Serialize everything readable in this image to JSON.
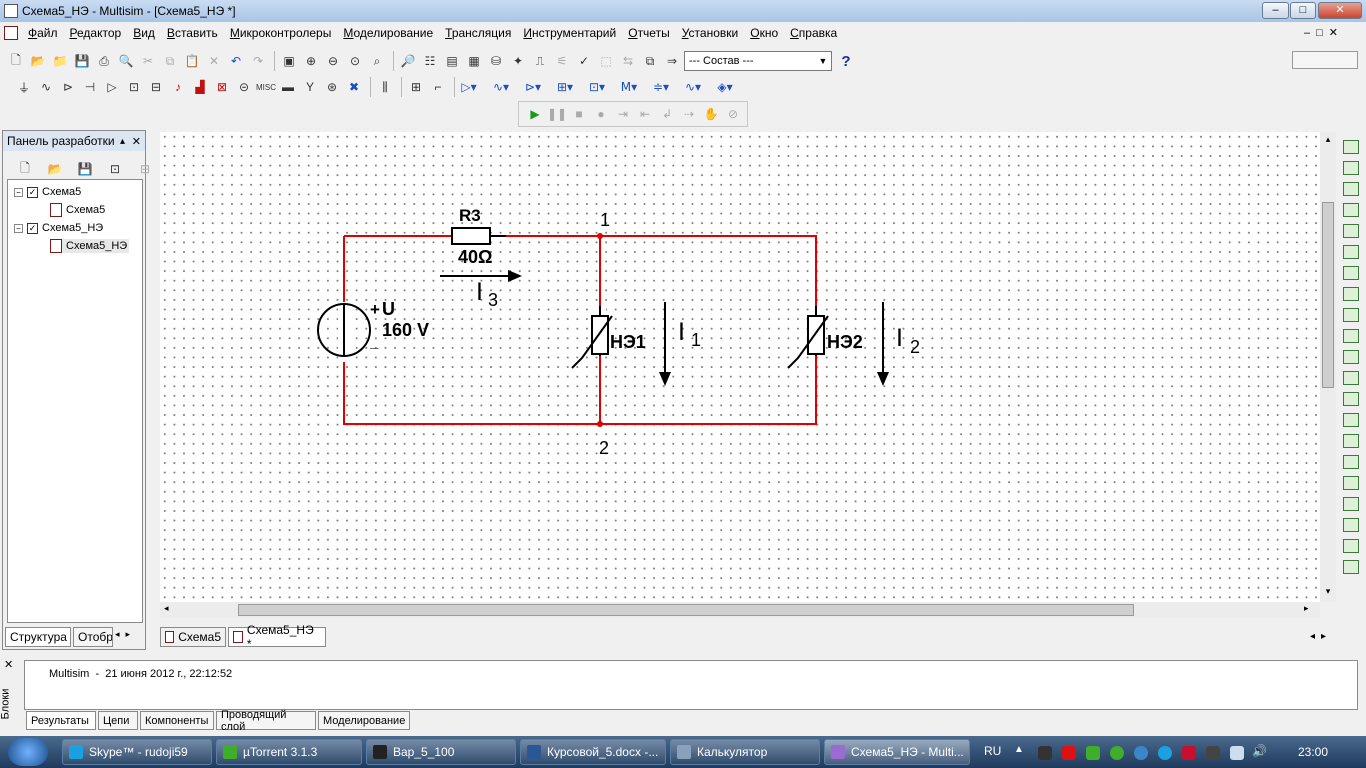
{
  "window": {
    "title": "Схема5_НЭ - Multisim - [Схема5_НЭ *]",
    "min_symbol": "‒",
    "max_symbol": "□",
    "close_symbol": "✕"
  },
  "menu": [
    "Файл",
    "Редактор",
    "Вид",
    "Вставить",
    "Микроконтролеры",
    "Моделирование",
    "Трансляция",
    "Инструментарий",
    "Отчеты",
    "Установки",
    "Окно",
    "Справка"
  ],
  "toolbar": {
    "combo_value": "--- Состав ---",
    "help_symbol": "?"
  },
  "design_panel": {
    "title": "Панель разработки",
    "tree": [
      {
        "label": "Схема5",
        "type": "folder"
      },
      {
        "label": "Схема5",
        "type": "sheet"
      },
      {
        "label": "Схема5_НЭ",
        "type": "folder"
      },
      {
        "label": "Схема5_НЭ",
        "type": "sheet"
      }
    ],
    "tabs": [
      "Структура",
      "Отобр"
    ]
  },
  "circuit": {
    "source": {
      "ref": "U",
      "value": "160 V",
      "plus": "+",
      "minus": "_"
    },
    "resistor": {
      "ref": "R3",
      "value": "40Ω"
    },
    "nodes": [
      "1",
      "2"
    ],
    "nonlinear": [
      {
        "ref": "НЭ1"
      },
      {
        "ref": "НЭ2"
      }
    ],
    "currents": [
      {
        "letter": "I",
        "index": "3"
      },
      {
        "letter": "I",
        "index": "1"
      },
      {
        "letter": "I",
        "index": "2"
      }
    ],
    "wire_color": "#e00000"
  },
  "sheet_tabs": [
    "Схема5",
    "Схема5_НЭ *"
  ],
  "bottom": {
    "side_label": "Блоки",
    "message": "Multisim  -  21 июня 2012 г., 22:12:52",
    "tabs": [
      "Результаты",
      "Цепи",
      "Компоненты",
      "Проводящий слой",
      "Моделирование"
    ]
  },
  "taskbar": {
    "items": [
      "Skype™ - rudoji59",
      "µTorrent 3.1.3",
      "Вар_5_100",
      "Курсовой_5.docx -...",
      "Калькулятор",
      "Схема5_НЭ - Multi..."
    ],
    "lang": "RU",
    "clock": "23:00"
  }
}
